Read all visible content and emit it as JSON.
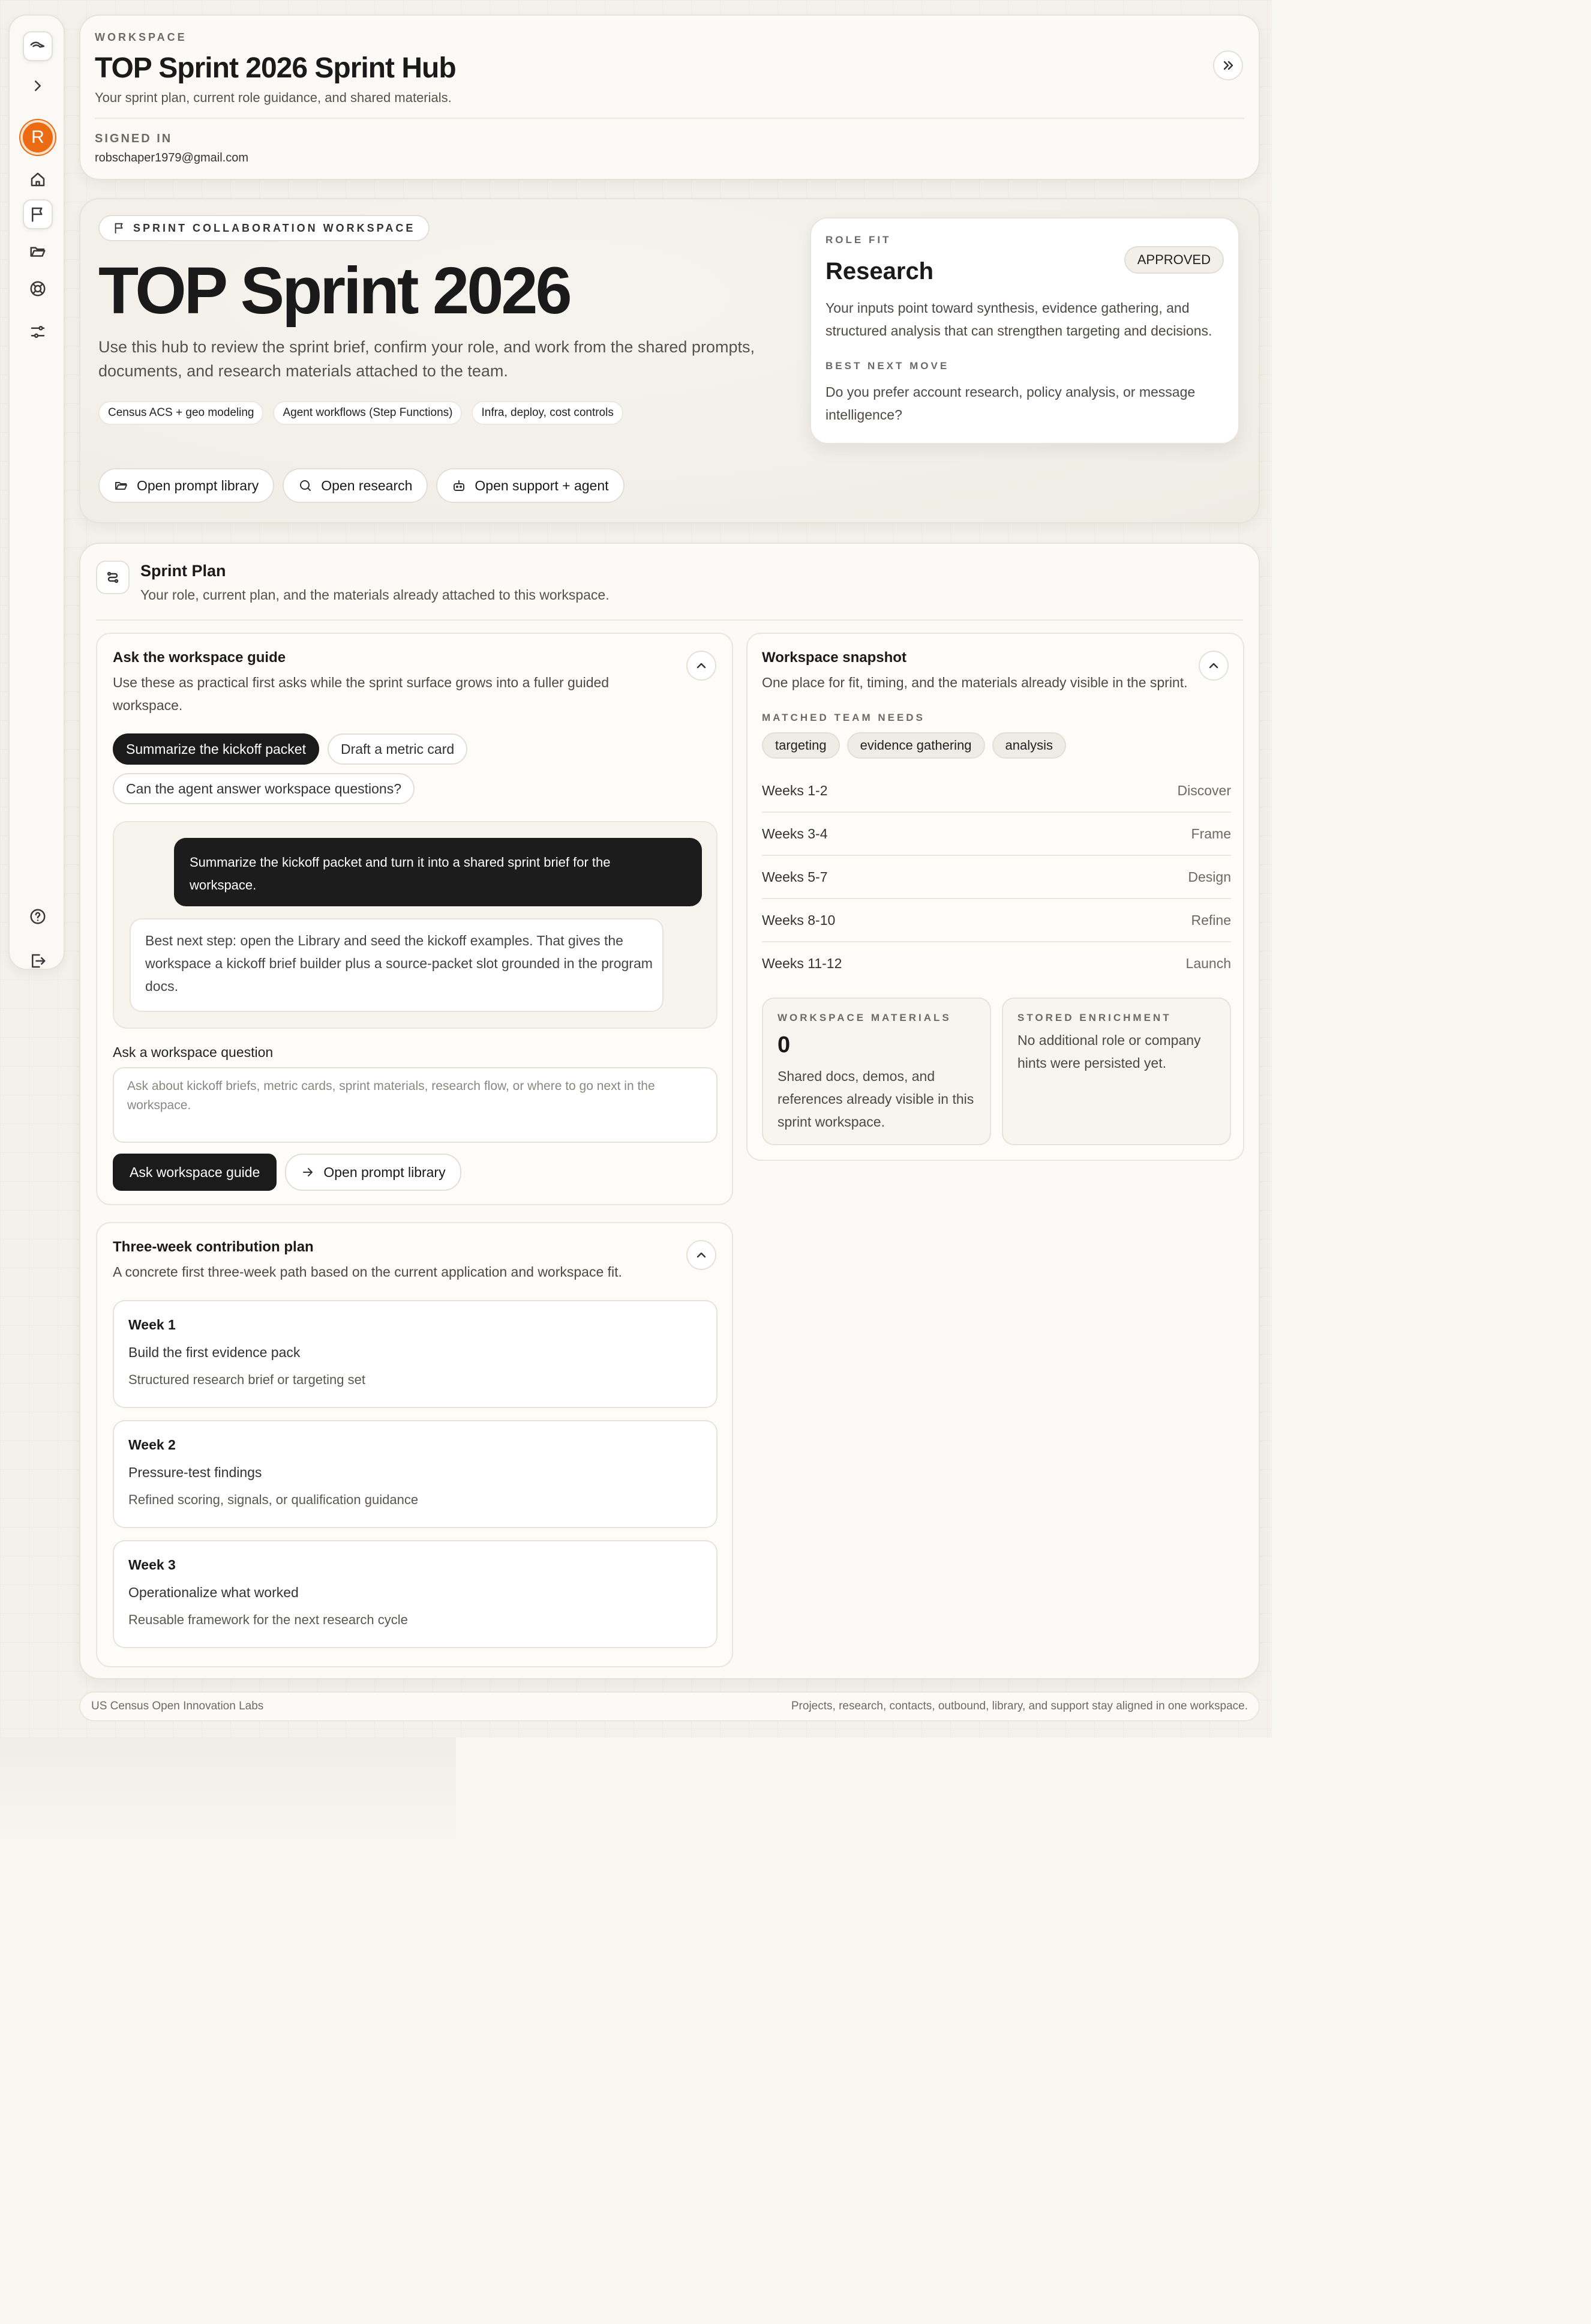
{
  "header": {
    "eyebrow": "WORKSPACE",
    "title": "TOP Sprint 2026 Sprint Hub",
    "subtitle": "Your sprint plan, current role guidance, and shared materials.",
    "signed_in_label": "SIGNED IN",
    "email": "robschaper1979@gmail.com"
  },
  "sidebar": {
    "avatar_initial": "R"
  },
  "hero": {
    "tag": "SPRINT COLLABORATION WORKSPACE",
    "title": "TOP Sprint 2026",
    "description_line1": "Use this hub to review the sprint brief, confirm your role, and work from the shared prompts,",
    "description_line2": "documents, and research materials attached to the team.",
    "chips": [
      "Census ACS + geo modeling",
      "Agent workflows (Step Functions)",
      "Infra, deploy, cost controls"
    ],
    "buttons": {
      "prompt_library": "Open prompt library",
      "research": "Open research",
      "support": "Open support + agent"
    }
  },
  "role_fit": {
    "eyebrow": "ROLE FIT",
    "role": "Research",
    "status": "APPROVED",
    "line1": "Your inputs point toward synthesis, evidence gathering, and",
    "line2": "structured analysis that can strengthen targeting and decisions.",
    "next_label": "BEST NEXT MOVE",
    "next_line1": "Do you prefer account research, policy analysis, or message",
    "next_line2": "intelligence?"
  },
  "plan": {
    "title": "Sprint Plan",
    "subtitle": "Your role, current plan, and the materials already attached to this workspace."
  },
  "guide": {
    "title": "Ask the workspace guide",
    "desc_line1": "Use these as practical first asks while the sprint surface grows into a fuller guided",
    "desc_line2": "workspace.",
    "chips": [
      "Summarize the kickoff packet",
      "Draft a metric card",
      "Can the agent answer workspace questions?"
    ],
    "user_msg_line1": "Summarize the kickoff packet and turn it into a shared sprint brief for the",
    "user_msg_line2": "workspace.",
    "reply_line1": "Best next step: open the Library and seed the kickoff examples. That gives the",
    "reply_line2": "workspace a kickoff brief builder plus a source-packet slot grounded in the program",
    "reply_line3": "docs.",
    "question_label": "Ask a workspace question",
    "placeholder_line1": "Ask about kickoff briefs, metric cards, sprint materials, research flow, or where to go next in the",
    "placeholder_line2": "workspace.",
    "ask_button": "Ask workspace guide",
    "library_button": "Open prompt library"
  },
  "snapshot": {
    "title": "Workspace snapshot",
    "subtitle": "One place for fit, timing, and the materials already visible in the sprint.",
    "needs_label": "MATCHED TEAM NEEDS",
    "needs": [
      "targeting",
      "evidence gathering",
      "analysis"
    ],
    "timeline": [
      {
        "weeks": "Weeks 1-2",
        "phase": "Discover"
      },
      {
        "weeks": "Weeks 3-4",
        "phase": "Frame"
      },
      {
        "weeks": "Weeks 5-7",
        "phase": "Design"
      },
      {
        "weeks": "Weeks 8-10",
        "phase": "Refine"
      },
      {
        "weeks": "Weeks 11-12",
        "phase": "Launch"
      }
    ],
    "materials_label": "WORKSPACE MATERIALS",
    "materials_count": "0",
    "materials_line1": "Shared docs, demos, and",
    "materials_line2": "references already visible in this",
    "materials_line3": "sprint workspace.",
    "enrichment_label": "STORED ENRICHMENT",
    "enrichment_line1": "No additional role or company",
    "enrichment_line2": "hints were persisted yet."
  },
  "contribution": {
    "title": "Three-week contribution plan",
    "subtitle": "A concrete first three-week path based on the current application and workspace fit.",
    "weeks": [
      {
        "label": "Week 1",
        "goal": "Build the first evidence pack",
        "output": "Structured research brief or targeting set"
      },
      {
        "label": "Week 2",
        "goal": "Pressure-test findings",
        "output": "Refined scoring, signals, or qualification guidance"
      },
      {
        "label": "Week 3",
        "goal": "Operationalize what worked",
        "output": "Reusable framework for the next research cycle"
      }
    ]
  },
  "footer": {
    "left": "US Census Open Innovation Labs",
    "right": "Projects, research, contacts, outbound, library, and support stay aligned in one workspace."
  }
}
